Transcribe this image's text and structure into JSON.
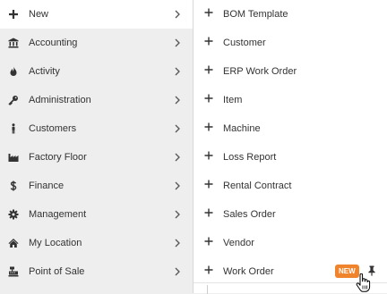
{
  "left_menu": {
    "items": [
      {
        "label": "New",
        "icon": "plus-icon"
      },
      {
        "label": "Accounting",
        "icon": "bank-icon"
      },
      {
        "label": "Activity",
        "icon": "flame-icon"
      },
      {
        "label": "Administration",
        "icon": "key-icon"
      },
      {
        "label": "Customers",
        "icon": "person-icon"
      },
      {
        "label": "Factory Floor",
        "icon": "factory-icon"
      },
      {
        "label": "Finance",
        "icon": "dollar-icon"
      },
      {
        "label": "Management",
        "icon": "gear-icon"
      },
      {
        "label": "My Location",
        "icon": "home-icon"
      },
      {
        "label": "Point of Sale",
        "icon": "cash-register-icon"
      }
    ]
  },
  "submenu": {
    "items": [
      {
        "label": "BOM Template"
      },
      {
        "label": "Customer"
      },
      {
        "label": "ERP Work Order"
      },
      {
        "label": "Item"
      },
      {
        "label": "Machine"
      },
      {
        "label": "Loss Report"
      },
      {
        "label": "Rental Contract"
      },
      {
        "label": "Sales Order"
      },
      {
        "label": "Vendor"
      },
      {
        "label": "Work Order",
        "badge": "NEW"
      }
    ]
  },
  "colors": {
    "badge": "#f0842c",
    "active_bg": "#ffffff",
    "menu_bg": "#eeeeee"
  }
}
